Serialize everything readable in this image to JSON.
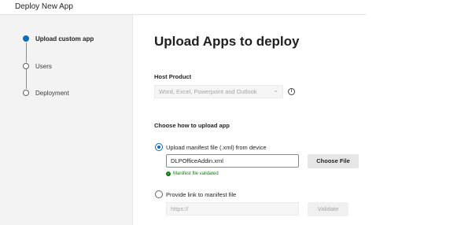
{
  "app_title": "Deploy New App",
  "steps": [
    {
      "label": "Upload custom app",
      "state": "active"
    },
    {
      "label": "Users",
      "state": "pending"
    },
    {
      "label": "Deployment",
      "state": "pending"
    }
  ],
  "main": {
    "title": "Upload Apps to deploy",
    "host_product": {
      "label": "Host Product",
      "value": "Word, Excel, Powerpoint and Outlook",
      "caret_icon": "chevron-down-icon",
      "info_icon": "info-icon"
    },
    "upload": {
      "label": "Choose how to upload app",
      "manifest_option": {
        "label": "Upload manifest file (.xml) from device",
        "selected": true,
        "file_value": "DLPOfficeAddin.xml",
        "choose_button": "Choose File",
        "validation_text": "Manifest file validated",
        "validation_icon": "check-icon"
      },
      "link_option": {
        "label": "Provide link to manifest file",
        "selected": false,
        "placeholder": "https://",
        "validate_button": "Validate"
      }
    }
  },
  "colors": {
    "accent": "#0f6cbd",
    "success": "#107c10",
    "sidebar_bg": "#f3f3f3",
    "disabled_text": "#a6a6a6"
  }
}
